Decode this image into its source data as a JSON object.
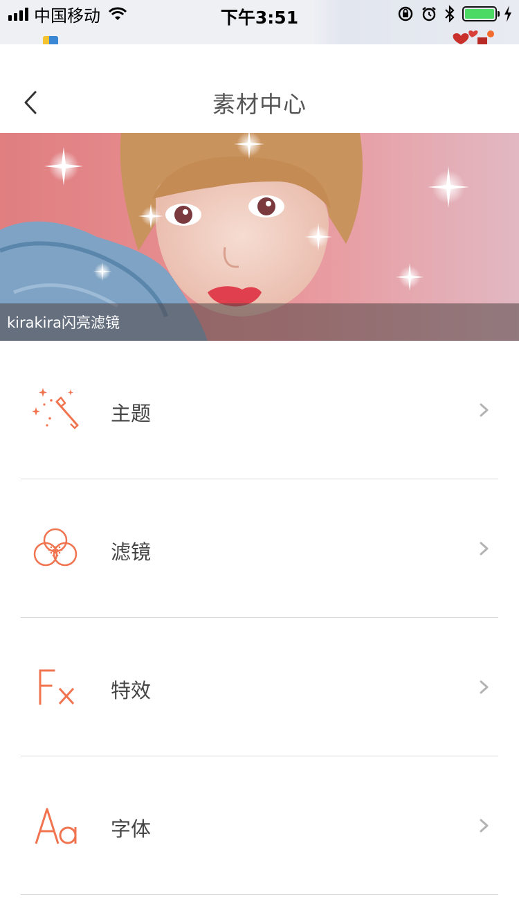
{
  "status_bar": {
    "carrier": "中国移动",
    "time": "下午3:51",
    "battery_color": "#4cd964"
  },
  "nav": {
    "title": "素材中心",
    "back_icon": "chevron-left-icon"
  },
  "banner": {
    "caption": "kirakira闪亮滤镜"
  },
  "menu": {
    "items": [
      {
        "label": "主题",
        "icon": "magic-wand-icon"
      },
      {
        "label": "滤镜",
        "icon": "filter-icon"
      },
      {
        "label": "特效",
        "icon": "fx-icon"
      },
      {
        "label": "字体",
        "icon": "font-icon"
      }
    ]
  },
  "colors": {
    "accent": "#f0744f",
    "title_text": "#555555",
    "label_text": "#444444",
    "divider": "#d9d9d9",
    "chevron": "#b3b3b3"
  }
}
